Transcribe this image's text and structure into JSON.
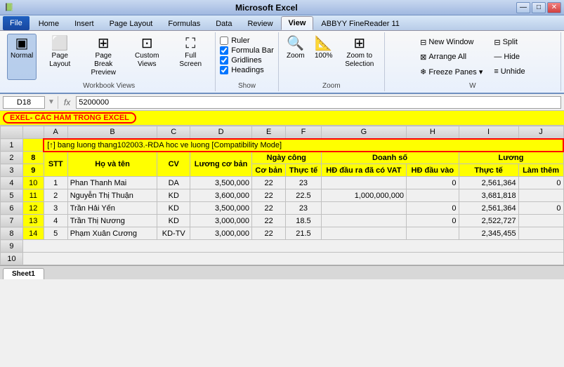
{
  "titlebar": {
    "text": "Microsoft Excel",
    "minimize": "—",
    "restore": "□",
    "close": "✕"
  },
  "tabs": [
    "File",
    "Home",
    "Insert",
    "Page Layout",
    "Formulas",
    "Data",
    "Review",
    "View",
    "ABBYY FineReader 11"
  ],
  "active_tab": "View",
  "ribbon": {
    "groups": [
      {
        "name": "Workbook Views",
        "items": [
          {
            "label": "Normal",
            "icon": "▣",
            "active": true
          },
          {
            "label": "Page Layout",
            "icon": "⬜"
          },
          {
            "label": "Page Break Preview",
            "icon": "⊞"
          },
          {
            "label": "Custom Views",
            "icon": "⊡"
          },
          {
            "label": "Full Screen",
            "icon": "⬜"
          }
        ]
      },
      {
        "name": "Show",
        "checkboxes": [
          {
            "label": "Ruler",
            "checked": false
          },
          {
            "label": "Formula Bar",
            "checked": true
          },
          {
            "label": "Gridlines",
            "checked": true
          },
          {
            "label": "Headings",
            "checked": true
          }
        ]
      },
      {
        "name": "Zoom",
        "items": [
          {
            "label": "Zoom",
            "icon": "🔍"
          },
          {
            "label": "100%",
            "icon": "📐"
          },
          {
            "label": "Zoom to Selection",
            "icon": "⊞"
          }
        ]
      },
      {
        "name": "Window",
        "items": [
          {
            "label": "New Window",
            "icon": "⊟"
          },
          {
            "label": "Arrange All",
            "icon": "⊠"
          },
          {
            "label": "Freeze Panes",
            "icon": "❄"
          },
          {
            "label": "Split",
            "icon": "|"
          },
          {
            "label": "Hide",
            "icon": "—"
          },
          {
            "label": "Unhide",
            "icon": "≡"
          }
        ]
      }
    ]
  },
  "formula_bar": {
    "cell_ref": "D18",
    "formula_icon": "fx",
    "formula_value": "5200000"
  },
  "excel_title": "EXEL- CÁC HÀM TRONG EXCEL",
  "row1_content": "[↑] bang luong thang102003.-RDA hoc ve luong  [Compatibility Mode]",
  "col_headers": [
    "",
    "A",
    "B",
    "C",
    "D",
    "E",
    "F",
    "G",
    "H",
    "I",
    "J"
  ],
  "header_row_nums": [
    "1",
    "2",
    "3",
    "4",
    "5",
    "6",
    "7",
    "8",
    "9",
    "10"
  ],
  "data": {
    "header_row2": {
      "row_num": "8",
      "A": "STT",
      "B": "Họ và tên",
      "C": "CV",
      "D": "Lương cơ bản",
      "E": "Ngày công",
      "G": "Doanh số",
      "I": "Lương"
    },
    "header_row3": {
      "row_num": "9",
      "E_sub1": "Cơ bản",
      "E_sub2": "Thực tế",
      "G_sub1": "HĐ đầu ra đã có VAT",
      "H_sub1": "HĐ đầu vào",
      "I_sub1": "Thực tế",
      "J_sub1": "Làm thêm"
    },
    "rows": [
      {
        "num": "4",
        "row_label": "10",
        "A": "1",
        "B": "Phan Thanh Mai",
        "C": "DA",
        "D": "3,500,000",
        "E1": "22",
        "E2": "23",
        "G": "",
        "H": "0",
        "I": "2,561,364",
        "J": "0"
      },
      {
        "num": "5",
        "row_label": "11",
        "A": "2",
        "B": "Nguyễn Thị Thuận",
        "C": "KD",
        "D": "3,600,000",
        "E1": "22",
        "E2": "22.5",
        "G": "1,000,000,000",
        "H": "",
        "I": "3,681,818",
        "J": ""
      },
      {
        "num": "6",
        "row_label": "12",
        "A": "3",
        "B": "Trần Hải Yến",
        "C": "KD",
        "D": "3,500,000",
        "E1": "22",
        "E2": "23",
        "G": "",
        "H": "0",
        "I": "2,561,364",
        "J": "0"
      },
      {
        "num": "7",
        "row_label": "13",
        "A": "4",
        "B": "Trần Thị Nương",
        "C": "KD",
        "D": "3,000,000",
        "E1": "22",
        "E2": "18.5",
        "G": "",
        "H": "0",
        "I": "2,522,727",
        "J": ""
      },
      {
        "num": "8",
        "row_label": "14",
        "A": "5",
        "B": "Phạm Xuân Cương",
        "C": "KD-TV",
        "D": "3,000,000",
        "E1": "22",
        "E2": "21.5",
        "G": "",
        "H": "",
        "I": "2,345,455",
        "J": ""
      }
    ]
  },
  "sheet_tab": "Sheet1"
}
